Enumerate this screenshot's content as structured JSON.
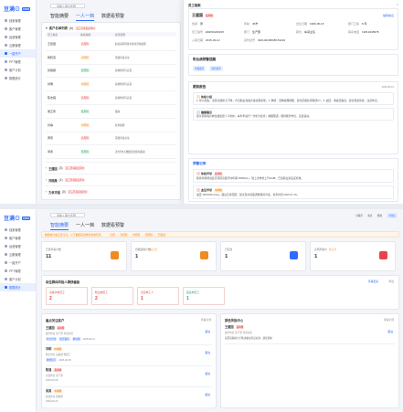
{
  "app": {
    "logo": "豆满⊙",
    "logo_badge": "CRM"
  },
  "sidebar": {
    "items": [
      {
        "label": "线索管理"
      },
      {
        "label": "客户管理"
      },
      {
        "label": "运营管理"
      },
      {
        "label": "云服管理"
      },
      {
        "label": "一键开户"
      },
      {
        "label": "PPT管理"
      },
      {
        "label": "客户计划"
      },
      {
        "label": "数据统计"
      }
    ],
    "active_index": 4
  },
  "search": {
    "placeholder": "请输入客户名称"
  },
  "tabs": [
    {
      "label": "智能摘要"
    },
    {
      "label": "一人一档"
    },
    {
      "label": "数据看预警"
    }
  ],
  "s1": {
    "group_title": "客户名单列表",
    "group_count": "(6)",
    "group_tag": "近三月满意度评价",
    "cols": [
      "员工姓名",
      "健康等级",
      "标签结果"
    ],
    "rows": [
      {
        "name": "王建国",
        "level": "高风险",
        "tag": "职业病风险客户建议尽快处理"
      },
      {
        "name": "杨晓燕",
        "level": "中风险",
        "tag": "需要持续关注"
      },
      {
        "name": "张丽娟",
        "level": "低风险",
        "tag": "其他检查待完善"
      },
      {
        "name": "刘明",
        "level": "中风险",
        "tag": "其他检查待完善"
      },
      {
        "name": "陈志强",
        "level": "高风险",
        "tag": "其他检查待完善"
      },
      {
        "name": "吴正伟",
        "level": "低风险",
        "tag": "慢病"
      },
      {
        "name": "孙静",
        "level": "中风险",
        "tag": "复查提醒"
      },
      {
        "name": "黄伟",
        "level": "高风险",
        "tag": "需要持续关注"
      },
      {
        "name": "郭勇",
        "level": "低风险",
        "tag": "近3月内无数据变化建议跟进"
      }
    ],
    "collapsed": [
      {
        "title": "王建国",
        "count": "(3)",
        "tag": "近三月满意度评价"
      },
      {
        "title": "刘晓燕",
        "count": "(1)",
        "tag": "近三月满意度评价"
      },
      {
        "title": "方卓华国",
        "count": "(0)",
        "tag": "近三月满意度评价"
      }
    ]
  },
  "panel": {
    "title": "员工档案",
    "name": "王建国",
    "name_tag": "高风险",
    "edit_label": "编辑信息",
    "info": [
      {
        "k": "性别",
        "v": "男"
      },
      {
        "k": "年龄",
        "v": "45岁"
      },
      {
        "k": "出生日期",
        "v": "1980-05-15"
      },
      {
        "k": "部门工龄",
        "v": "8 年"
      },
      {
        "k": "员工编号",
        "v": "EMP20230015"
      },
      {
        "k": "部门",
        "v": "生产部"
      },
      {
        "k": "职位",
        "v": "车间主任"
      },
      {
        "k": "联系电话",
        "v": "13812345678"
      },
      {
        "k": "入职日期",
        "v": "2015-03-12"
      },
      {
        "k": "身份证号",
        "v": "320102198005151234"
      }
    ],
    "alert_title": "职业病预警提醒",
    "alert_btns": [
      "查看报告",
      "预约复查"
    ],
    "trace_title": "跟踪报告",
    "trace_date": "2025-06-12",
    "trace_note1_title": "体检小结",
    "trace_note1": "1. 听力损失：双耳高频听力下降，符合职业性噪声聋初期表现。2. 肺部：双肺纹理增粗，建议定期复查胸部CT。3. 血压：收缩压偏高，建议低盐饮食，注意休息。",
    "trace_note2_title": "健康建议",
    "trace_note2": "建议调离噪声岗位或加强个人防护，每半年进行一次听力复查；戒烟限酒，保持规律作息，适当运动。",
    "alert2_title": "预警记录",
    "alert2_items": [
      {
        "title": "体检异常",
        "tag": "高风险",
        "text": "纯音听阈测试显示双耳高频平均听阈 45dB(HL)，较上次体检上升10dB，已达职业禁忌证标准。"
      },
      {
        "title": "血压异常",
        "tag": "中风险",
        "text": "血压 160/100mmHg，超过正常范围，建议及时就医调整用药方案，复查时间 2025-07-15。"
      },
      {
        "title": "肺功能异常",
        "tag": "中风险",
        "text": "FEV1/FVC 比值 68%，提示轻度阻塞性通气功能障碍，需结合胸片结果综合评估。"
      }
    ]
  },
  "s2": {
    "notice": "数据统计截止至今日，以下数据来自体检系统同步。",
    "notice_tags": [
      "全部",
      "高风险",
      "中风险",
      "低风险",
      "已跟进"
    ],
    "top_right": [
      "小程序",
      "消息",
      "帮助"
    ],
    "user": "管理员",
    "stats": [
      {
        "label": "已筛查客户数",
        "value": "11",
        "sub": ""
      },
      {
        "label": "待跟进客户数",
        "value": "1",
        "sub": "较上月"
      },
      {
        "label": "已回访",
        "value": "1",
        "sub": ""
      },
      {
        "label": "高风险客户",
        "value": "1",
        "sub": "较上月"
      }
    ],
    "focus_title": "岗位群体风险人群快看板",
    "focus_btns": [
      "查看更多",
      "导出"
    ],
    "focus_cards": [
      {
        "label": "高噪声岗员工",
        "value": "2",
        "color": "#e54545"
      },
      {
        "label": "粉尘岗员工",
        "value": "2",
        "color": "#e54545"
      },
      {
        "label": "高温岗工人",
        "value": "1",
        "color": "#e54545"
      },
      {
        "label": "夜班岗员工",
        "value": "1",
        "color": "#2aa86b"
      }
    ],
    "left_title": "重点关注客户",
    "left_more": "查看全部",
    "left_items": [
      {
        "name": "王建国",
        "tag": "高风险",
        "meta": "噪声作业  生产部  车间主任",
        "chips": [
          "听力异常",
          "血压偏高",
          "肺功能"
        ],
        "date": "2025-06-12",
        "btn": "跟进"
      },
      {
        "name": "刘明",
        "tag": "中风险",
        "meta": "粉尘作业  设备部  维修工",
        "chips": [
          "肺部结节"
        ],
        "date": "2025-06-08",
        "btn": "跟进"
      },
      {
        "name": "陈强",
        "tag": "高风险",
        "meta": "高温作业  生产部",
        "chips": [],
        "date": "2025-05-28",
        "btn": "跟进"
      },
      {
        "name": "吴英",
        "tag": "中风险",
        "meta": "夜班作业  质检部",
        "chips": [],
        "date": "2025-05-20",
        "btn": "跟进"
      }
    ],
    "right_title": "报告风险中心",
    "right_more": "查看全部",
    "right_item": {
      "name": "王建国",
      "tag": "高风险",
      "meta": "噪声作业  生产部  车间主任",
      "text": "双耳高频听力下降达职业禁忌标准，建议调岗"
    },
    "right_btn": "跟进"
  }
}
